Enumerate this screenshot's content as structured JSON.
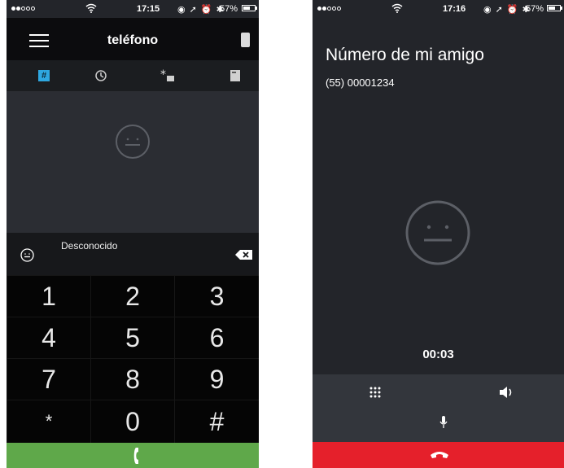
{
  "status_left": {
    "time": "17:15",
    "battery": "57%",
    "icons": "◉ ➚ ⏰ ✱"
  },
  "status_right": {
    "time": "17:16",
    "battery": "57%",
    "icons": "◉ ➚ ⏰ ✱"
  },
  "dialer": {
    "title": "teléfono",
    "caller_label": "Desconocido",
    "keys": [
      "1",
      "2",
      "3",
      "4",
      "5",
      "6",
      "7",
      "8",
      "9",
      "*",
      "0",
      "#"
    ],
    "tabs": [
      "dialpad-tab",
      "recents-tab",
      "favorites-tab",
      "contacts-tab"
    ],
    "tab_dialer_glyph": "#"
  },
  "in_call": {
    "contact_name": "Número de mi amigo",
    "contact_number": "(55) 00001234",
    "timer": "00:03"
  },
  "colors": {
    "accent": "#2ea7e0",
    "call_green": "#5fa84a",
    "hangup_red": "#e5202b",
    "background": "#23252a"
  },
  "icons": {
    "avatar": "smiley-face-icon",
    "backspace": "backspace-icon",
    "call": "phone-handset-icon",
    "hangup": "hangup-icon",
    "dialpad": "dialpad-icon",
    "speaker": "speaker-icon",
    "mute": "microphone-icon"
  }
}
